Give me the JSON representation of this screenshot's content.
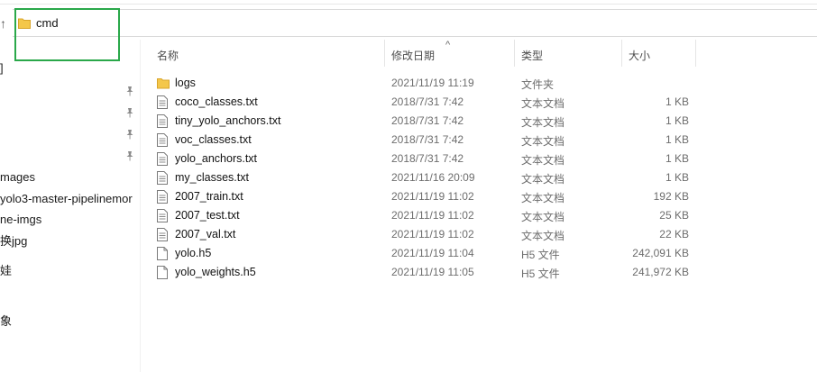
{
  "address_bar": {
    "path": "cmd"
  },
  "nav_pane": {
    "items": [
      {
        "label": "]",
        "pinned": false
      },
      {
        "label": "",
        "pinned": true
      },
      {
        "label": "",
        "pinned": true
      },
      {
        "label": "",
        "pinned": true
      },
      {
        "label": "",
        "pinned": true
      },
      {
        "label": "mages",
        "pinned": false
      },
      {
        "label": "yolo3-master-pipelinemor",
        "pinned": false
      },
      {
        "label": "ne-imgs",
        "pinned": false
      },
      {
        "label": "换jpg",
        "pinned": false
      },
      {
        "label": "娃",
        "pinned": false
      },
      {
        "label": "象",
        "pinned": false
      }
    ]
  },
  "columns": {
    "name": "名称",
    "date": "修改日期",
    "type": "类型",
    "size": "大小"
  },
  "files": [
    {
      "name": "logs",
      "date": "2021/11/19 11:19",
      "type": "文件夹",
      "size": "",
      "icon": "folder-icon"
    },
    {
      "name": "coco_classes.txt",
      "date": "2018/7/31 7:42",
      "type": "文本文档",
      "size": "1 KB",
      "icon": "text-file-icon"
    },
    {
      "name": "tiny_yolo_anchors.txt",
      "date": "2018/7/31 7:42",
      "type": "文本文档",
      "size": "1 KB",
      "icon": "text-file-icon"
    },
    {
      "name": "voc_classes.txt",
      "date": "2018/7/31 7:42",
      "type": "文本文档",
      "size": "1 KB",
      "icon": "text-file-icon"
    },
    {
      "name": "yolo_anchors.txt",
      "date": "2018/7/31 7:42",
      "type": "文本文档",
      "size": "1 KB",
      "icon": "text-file-icon"
    },
    {
      "name": "my_classes.txt",
      "date": "2021/11/16 20:09",
      "type": "文本文档",
      "size": "1 KB",
      "icon": "text-file-icon"
    },
    {
      "name": "2007_train.txt",
      "date": "2021/11/19 11:02",
      "type": "文本文档",
      "size": "192 KB",
      "icon": "text-file-icon"
    },
    {
      "name": "2007_test.txt",
      "date": "2021/11/19 11:02",
      "type": "文本文档",
      "size": "25 KB",
      "icon": "text-file-icon"
    },
    {
      "name": "2007_val.txt",
      "date": "2021/11/19 11:02",
      "type": "文本文档",
      "size": "22 KB",
      "icon": "text-file-icon"
    },
    {
      "name": "yolo.h5",
      "date": "2021/11/19 11:04",
      "type": "H5 文件",
      "size": "242,091 KB",
      "icon": "blank-file-icon"
    },
    {
      "name": "yolo_weights.h5",
      "date": "2021/11/19 11:05",
      "type": "H5 文件",
      "size": "241,972 KB",
      "icon": "blank-file-icon"
    }
  ],
  "colors": {
    "highlight_box": "#2aa84a",
    "folder": "#f4c74a"
  }
}
